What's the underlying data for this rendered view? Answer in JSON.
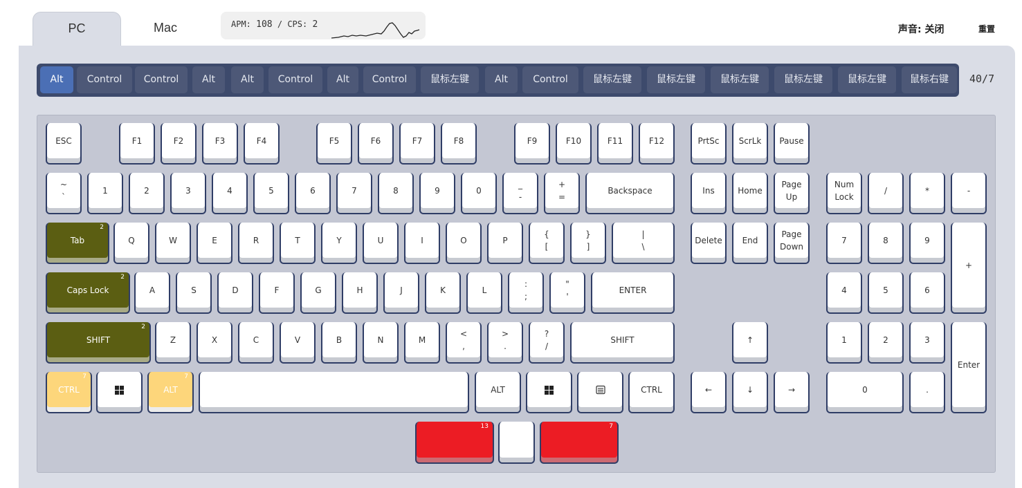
{
  "tabs": [
    "PC",
    "Mac"
  ],
  "stats": {
    "apm_label": "APM:",
    "apm_value": "108",
    "sep": "/",
    "cps_label": "CPS:",
    "cps_value": "2"
  },
  "sound": {
    "label": "声音:",
    "value": "关闭"
  },
  "reset_label": "重置",
  "history": {
    "items": [
      "Alt",
      "Control",
      "Control",
      "Alt",
      "Alt",
      "Control",
      "Alt",
      "Control",
      "鼠标左键",
      "Alt",
      "Control",
      "鼠标左键",
      "鼠标左键",
      "鼠标左键",
      "鼠标左键",
      "鼠标左键",
      "鼠标右键"
    ],
    "active_index": 0,
    "count": "40/7"
  },
  "colors": {
    "accent": "#4b6fb5",
    "key_frame": "#2f3d66",
    "green": "#5b5e12",
    "yellow": "#fdd67b",
    "red": "#ec1c24"
  },
  "keys": [
    {
      "name": "key-esc",
      "label": "ESC"
    },
    {
      "name": "key-f1",
      "label": "F1"
    },
    {
      "name": "key-f2",
      "label": "F2"
    },
    {
      "name": "key-f3",
      "label": "F3"
    },
    {
      "name": "key-f4",
      "label": "F4"
    },
    {
      "name": "key-f5",
      "label": "F5"
    },
    {
      "name": "key-f6",
      "label": "F6"
    },
    {
      "name": "key-f7",
      "label": "F7"
    },
    {
      "name": "key-f8",
      "label": "F8"
    },
    {
      "name": "key-f9",
      "label": "F9"
    },
    {
      "name": "key-f10",
      "label": "F10"
    },
    {
      "name": "key-f11",
      "label": "F11"
    },
    {
      "name": "key-f12",
      "label": "F12"
    },
    {
      "name": "key-prtsc",
      "label": "PrtSc"
    },
    {
      "name": "key-scrlk",
      "label": "ScrLk"
    },
    {
      "name": "key-pause",
      "label": "Pause"
    },
    {
      "name": "key-tilde",
      "label": "~\n`"
    },
    {
      "name": "key-1",
      "label": "1"
    },
    {
      "name": "key-2",
      "label": "2"
    },
    {
      "name": "key-3",
      "label": "3"
    },
    {
      "name": "key-4",
      "label": "4"
    },
    {
      "name": "key-5",
      "label": "5"
    },
    {
      "name": "key-6",
      "label": "6"
    },
    {
      "name": "key-7",
      "label": "7"
    },
    {
      "name": "key-8",
      "label": "8"
    },
    {
      "name": "key-9",
      "label": "9"
    },
    {
      "name": "key-0",
      "label": "0"
    },
    {
      "name": "key-minus",
      "label": "_\n-"
    },
    {
      "name": "key-equal",
      "label": "+\n="
    },
    {
      "name": "key-backspace",
      "label": "Backspace"
    },
    {
      "name": "key-ins",
      "label": "Ins"
    },
    {
      "name": "key-home",
      "label": "Home"
    },
    {
      "name": "key-pageup",
      "label": "Page\nUp"
    },
    {
      "name": "key-numlock",
      "label": "Num\nLock"
    },
    {
      "name": "key-num-slash",
      "label": "/"
    },
    {
      "name": "key-num-star",
      "label": "*"
    },
    {
      "name": "key-num-minus",
      "label": "-"
    },
    {
      "name": "key-tab",
      "label": "Tab",
      "count": "2",
      "color": "green"
    },
    {
      "name": "key-q",
      "label": "Q"
    },
    {
      "name": "key-w",
      "label": "W"
    },
    {
      "name": "key-e",
      "label": "E"
    },
    {
      "name": "key-r",
      "label": "R"
    },
    {
      "name": "key-t",
      "label": "T"
    },
    {
      "name": "key-y",
      "label": "Y"
    },
    {
      "name": "key-u",
      "label": "U"
    },
    {
      "name": "key-i",
      "label": "I"
    },
    {
      "name": "key-o",
      "label": "O"
    },
    {
      "name": "key-p",
      "label": "P"
    },
    {
      "name": "key-lbracket",
      "label": "{\n["
    },
    {
      "name": "key-rbracket",
      "label": "}\n]"
    },
    {
      "name": "key-backslash",
      "label": "|\n\\"
    },
    {
      "name": "key-delete",
      "label": "Delete"
    },
    {
      "name": "key-end",
      "label": "End"
    },
    {
      "name": "key-pagedown",
      "label": "Page\nDown"
    },
    {
      "name": "key-num-7",
      "label": "7"
    },
    {
      "name": "key-num-8",
      "label": "8"
    },
    {
      "name": "key-num-9",
      "label": "9"
    },
    {
      "name": "key-num-plus",
      "label": "+"
    },
    {
      "name": "key-capslock",
      "label": "Caps Lock",
      "count": "2",
      "color": "green"
    },
    {
      "name": "key-a",
      "label": "A"
    },
    {
      "name": "key-s",
      "label": "S"
    },
    {
      "name": "key-d",
      "label": "D"
    },
    {
      "name": "key-f",
      "label": "F"
    },
    {
      "name": "key-g",
      "label": "G"
    },
    {
      "name": "key-h",
      "label": "H"
    },
    {
      "name": "key-j",
      "label": "J"
    },
    {
      "name": "key-k",
      "label": "K"
    },
    {
      "name": "key-l",
      "label": "L"
    },
    {
      "name": "key-semicolon",
      "label": ":\n;"
    },
    {
      "name": "key-quote",
      "label": "\"\n'"
    },
    {
      "name": "key-enter",
      "label": "ENTER"
    },
    {
      "name": "key-num-4",
      "label": "4"
    },
    {
      "name": "key-num-5",
      "label": "5"
    },
    {
      "name": "key-num-6",
      "label": "6"
    },
    {
      "name": "key-lshift",
      "label": "SHIFT",
      "count": "2",
      "color": "green"
    },
    {
      "name": "key-z",
      "label": "Z"
    },
    {
      "name": "key-x",
      "label": "X"
    },
    {
      "name": "key-c",
      "label": "C"
    },
    {
      "name": "key-v",
      "label": "V"
    },
    {
      "name": "key-b",
      "label": "B"
    },
    {
      "name": "key-n",
      "label": "N"
    },
    {
      "name": "key-m",
      "label": "M"
    },
    {
      "name": "key-comma",
      "label": "<\n,"
    },
    {
      "name": "key-period",
      "label": ">\n."
    },
    {
      "name": "key-slash",
      "label": "?\n/"
    },
    {
      "name": "key-rshift",
      "label": "SHIFT"
    },
    {
      "name": "key-up",
      "label": "↑"
    },
    {
      "name": "key-num-1",
      "label": "1"
    },
    {
      "name": "key-num-2",
      "label": "2"
    },
    {
      "name": "key-num-3",
      "label": "3"
    },
    {
      "name": "key-num-enter",
      "label": "Enter"
    },
    {
      "name": "key-lctrl",
      "label": "CTRL",
      "count": "7",
      "color": "yellow"
    },
    {
      "name": "key-lwin",
      "label": "",
      "icon": "windows"
    },
    {
      "name": "key-lalt",
      "label": "ALT",
      "count": "7",
      "color": "yellow"
    },
    {
      "name": "key-space",
      "label": ""
    },
    {
      "name": "key-ralt",
      "label": "ALT"
    },
    {
      "name": "key-rwin",
      "label": "",
      "icon": "windows"
    },
    {
      "name": "key-menu",
      "label": "",
      "icon": "menu"
    },
    {
      "name": "key-rctrl",
      "label": "CTRL"
    },
    {
      "name": "key-left",
      "label": "←"
    },
    {
      "name": "key-down",
      "label": "↓"
    },
    {
      "name": "key-right",
      "label": "→"
    },
    {
      "name": "key-num-0",
      "label": "0"
    },
    {
      "name": "key-num-dot",
      "label": "."
    },
    {
      "name": "mouse-left-button",
      "label": "",
      "count": "13",
      "color": "red"
    },
    {
      "name": "mouse-wheel",
      "label": ""
    },
    {
      "name": "mouse-right-button",
      "label": "",
      "count": "7",
      "color": "red"
    }
  ]
}
